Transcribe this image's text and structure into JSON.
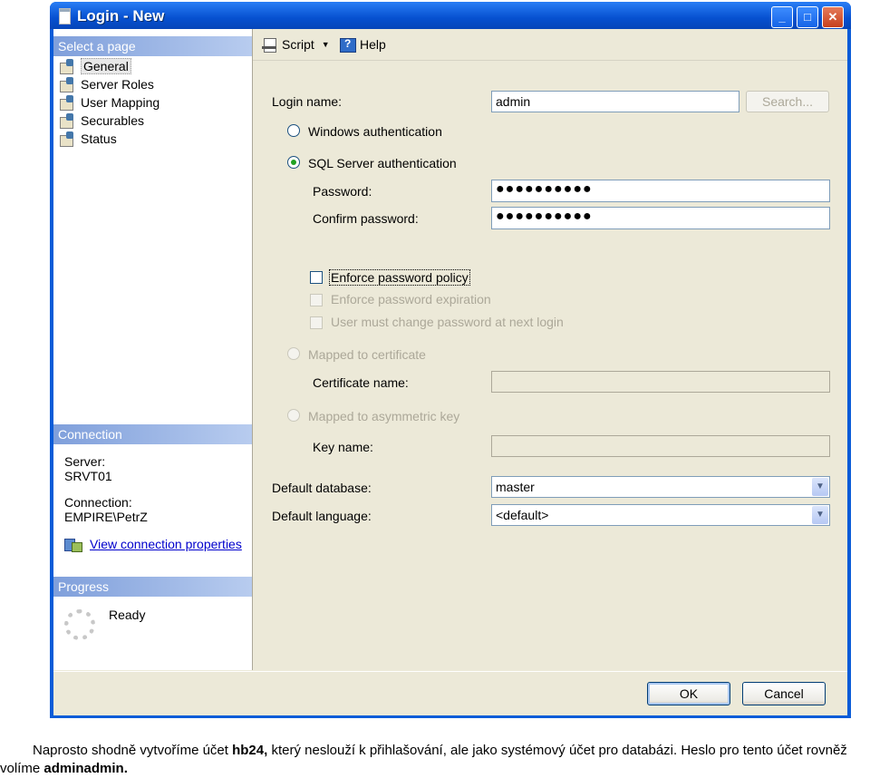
{
  "window": {
    "title": "Login - New",
    "min": "_",
    "max": "□",
    "close": "✕"
  },
  "sidebar": {
    "select_page_header": "Select a page",
    "items": [
      {
        "label": "General",
        "icon": "page-properties-icon",
        "selected": true
      },
      {
        "label": "Server Roles",
        "icon": "page-properties-icon",
        "selected": false
      },
      {
        "label": "User Mapping",
        "icon": "page-properties-icon",
        "selected": false
      },
      {
        "label": "Securables",
        "icon": "page-properties-icon",
        "selected": false
      },
      {
        "label": "Status",
        "icon": "page-properties-icon",
        "selected": false
      }
    ],
    "connection_header": "Connection",
    "server_label": "Server:",
    "server_value": "SRVT01",
    "connection_label": "Connection:",
    "connection_value": "EMPIRE\\PetrZ",
    "view_link": "View connection properties",
    "progress_header": "Progress",
    "progress_status": "Ready"
  },
  "toolbar": {
    "script": "Script",
    "help": "Help"
  },
  "form": {
    "login_name_label": "Login name:",
    "login_name_value": "admin",
    "search_button": "Search...",
    "windows_auth": "Windows authentication",
    "sql_auth": "SQL Server authentication",
    "password_label": "Password:",
    "password_value": "●●●●●●●●●●",
    "confirm_label": "Confirm password:",
    "confirm_value": "●●●●●●●●●●",
    "enforce_policy": "Enforce password policy",
    "enforce_expiration": "Enforce password expiration",
    "must_change": "User must change password at next login",
    "mapped_cert": "Mapped to certificate",
    "cert_name_label": "Certificate name:",
    "mapped_asym": "Mapped to asymmetric key",
    "key_name_label": "Key name:",
    "default_db_label": "Default database:",
    "default_db_value": "master",
    "default_lang_label": "Default language:",
    "default_lang_value": "<default>"
  },
  "buttons": {
    "ok": "OK",
    "cancel": "Cancel"
  },
  "caption": {
    "part1": "Naprosto shodně vytvoříme účet ",
    "bold1": "hb24,",
    "part2": " který neslouží k přihlašování, ale jako systémový účet pro databázi. Heslo pro tento účet rovněž volíme ",
    "bold2": "adminadmin."
  },
  "colors": {
    "titlebar": "#0650d0",
    "dialog_bg": "#ece9d8",
    "section_header": "#7f9fdb",
    "link": "#0000cc"
  }
}
